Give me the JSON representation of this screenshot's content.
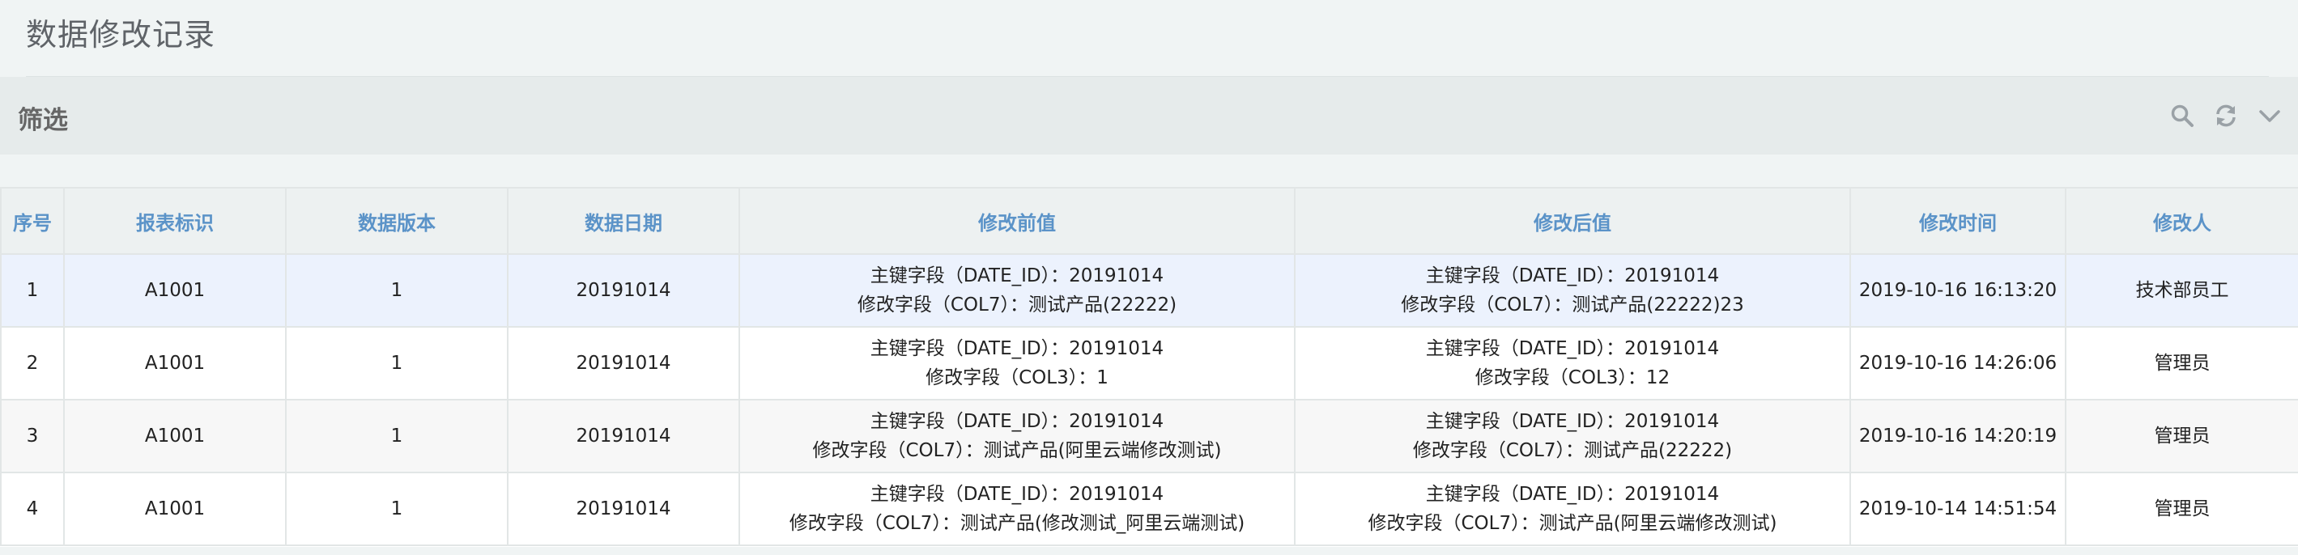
{
  "page": {
    "title": "数据修改记录"
  },
  "filter": {
    "title": "筛选",
    "icons": [
      "search-icon",
      "refresh-icon",
      "chevron-down-icon"
    ]
  },
  "table": {
    "columns": [
      "序号",
      "报表标识",
      "数据版本",
      "数据日期",
      "修改前值",
      "修改后值",
      "修改时间",
      "修改人"
    ],
    "rows": [
      {
        "index": "1",
        "report_id": "A1001",
        "version": "1",
        "date": "20191014",
        "before": [
          "主键字段（DATE_ID）：20191014",
          "修改字段（COL7）：测试产品(22222)"
        ],
        "after": [
          "主键字段（DATE_ID）：20191014",
          "修改字段（COL7）：测试产品(22222)23"
        ],
        "time": "2019-10-16 16:13:20",
        "user": "技术部员工"
      },
      {
        "index": "2",
        "report_id": "A1001",
        "version": "1",
        "date": "20191014",
        "before": [
          "主键字段（DATE_ID）：20191014",
          "修改字段（COL3）：1"
        ],
        "after": [
          "主键字段（DATE_ID）：20191014",
          "修改字段（COL3）：12"
        ],
        "time": "2019-10-16 14:26:06",
        "user": "管理员"
      },
      {
        "index": "3",
        "report_id": "A1001",
        "version": "1",
        "date": "20191014",
        "before": [
          "主键字段（DATE_ID）：20191014",
          "修改字段（COL7）：测试产品(阿里云端修改测试)"
        ],
        "after": [
          "主键字段（DATE_ID）：20191014",
          "修改字段（COL7）：测试产品(22222)"
        ],
        "time": "2019-10-16 14:20:19",
        "user": "管理员"
      },
      {
        "index": "4",
        "report_id": "A1001",
        "version": "1",
        "date": "20191014",
        "before": [
          "主键字段（DATE_ID）：20191014",
          "修改字段（COL7）：测试产品(修改测试_阿里云端测试)"
        ],
        "after": [
          "主键字段（DATE_ID）：20191014",
          "修改字段（COL7）：测试产品(阿里云端修改测试)"
        ],
        "time": "2019-10-14 14:51:54",
        "user": "管理员"
      }
    ]
  },
  "colors": {
    "header_text": "#5b93c8",
    "selected_row": "#ecf2fd",
    "striped_row": "#f7f7f7",
    "filter_bar": "#e6ebeb",
    "page_background": "#f0f4f4"
  }
}
